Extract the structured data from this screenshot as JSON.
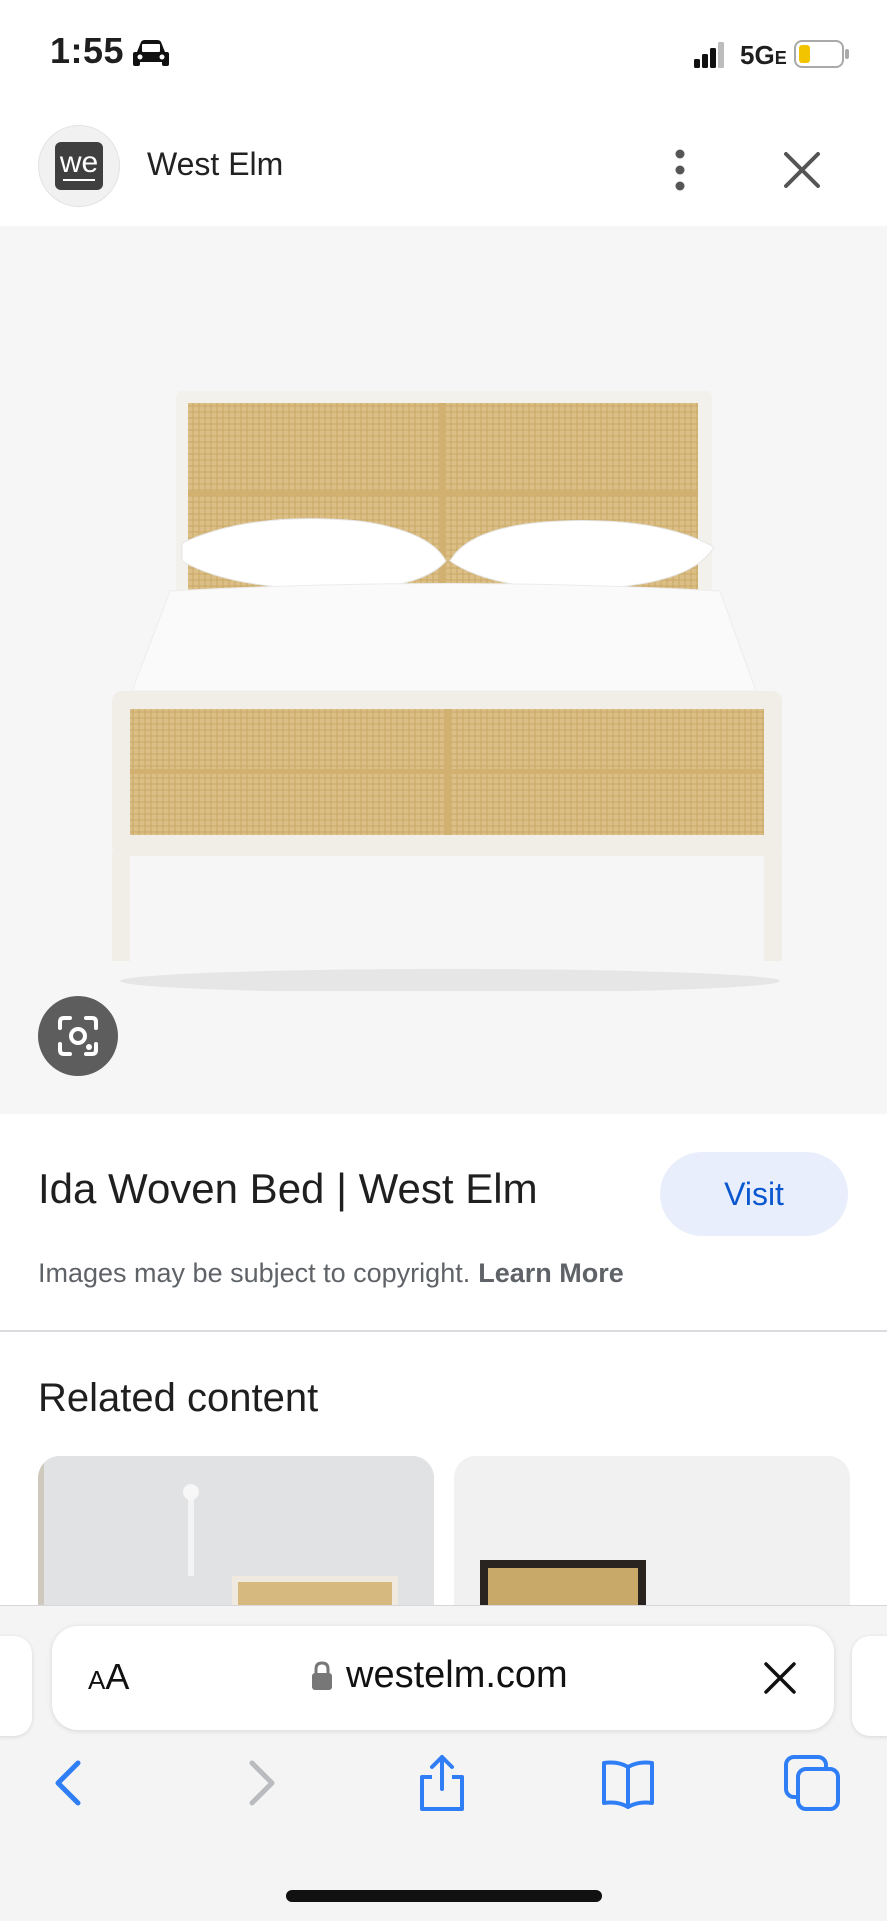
{
  "status_bar": {
    "time": "1:55",
    "network": "5G",
    "network_suffix": "E",
    "icons": [
      "car-icon",
      "signal-icon",
      "battery-icon"
    ]
  },
  "header": {
    "site_logo_text": "we",
    "site_name": "West Elm",
    "icons": [
      "more-vert-icon",
      "close-icon"
    ]
  },
  "image_viewer": {
    "image_description_icon": "bed-photo",
    "lens_icon": "lens-icon"
  },
  "result": {
    "title": "Ida Woven Bed | West Elm",
    "visit_label": "Visit",
    "copyright_text": "Images may be subject to copyright.",
    "learn_more_label": "Learn More"
  },
  "related": {
    "heading": "Related content"
  },
  "safari": {
    "reader_label_big": "A",
    "reader_label_small": "A",
    "url": "westelm.com",
    "toolbar_icons": [
      "back-icon",
      "forward-icon",
      "share-icon",
      "bookmarks-icon",
      "tabs-icon"
    ]
  },
  "colors": {
    "accent_blue": "#0b57d0",
    "visit_bg": "#e8eefb",
    "image_bg": "#f6f6f6",
    "safari_icon_blue": "#2f7ef6"
  }
}
